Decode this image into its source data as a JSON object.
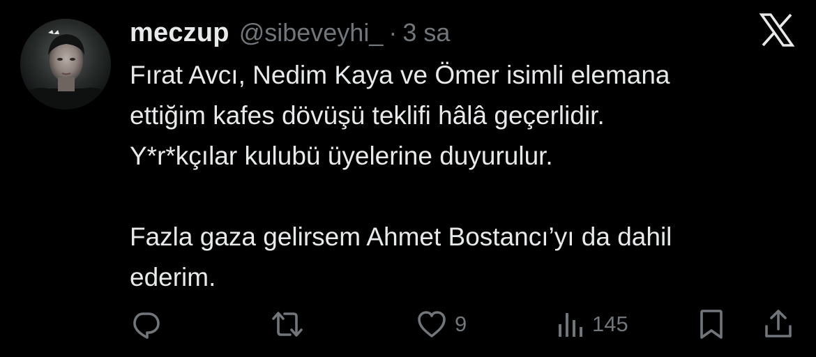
{
  "tweet": {
    "author": {
      "display_name": "meczup",
      "handle": "@sibeveyhi_",
      "avatar": "profile-photo"
    },
    "separator": "·",
    "timestamp": "3 sa",
    "platform_logo": "x-logo-icon",
    "text": "Fırat Avcı, Nedim Kaya ve Ömer isimli elemana\nettiğim kafes dövüşü teklifi hâlâ geçerlidir.\nY*r*kçılar kulubü üyelerine duyurulur.\n\nFazla gaza gelirsem Ahmet Bostancı’yı da dahil\nederim.",
    "actions": {
      "reply": {
        "icon": "reply-icon"
      },
      "retweet": {
        "icon": "retweet-icon"
      },
      "like": {
        "icon": "heart-icon",
        "count": "9"
      },
      "views": {
        "icon": "views-icon",
        "count": "145"
      },
      "bookmark": {
        "icon": "bookmark-icon"
      },
      "share": {
        "icon": "share-icon"
      }
    }
  },
  "colors": {
    "background": "#000000",
    "primary_text": "#e7e9ea",
    "secondary_text": "#71767b"
  }
}
